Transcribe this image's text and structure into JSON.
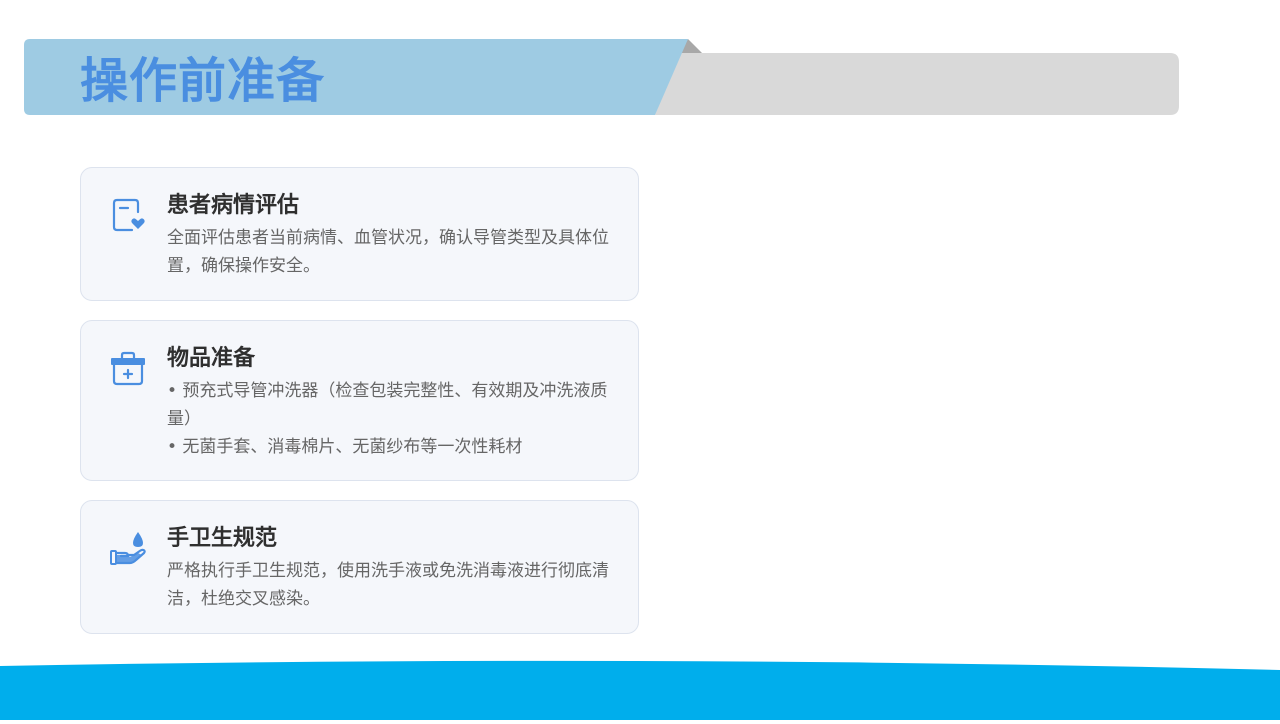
{
  "colors": {
    "banner_blue": "#9ecbe3",
    "banner_gray": "#d9d9d9",
    "title_text": "#4a8ee0",
    "icon_blue": "#4a8ee0",
    "card_background": "#f5f7fb",
    "footer_blue": "#00aeec"
  },
  "header": {
    "title": "操作前准备"
  },
  "cards": [
    {
      "icon": "clipboard-heart-icon",
      "title": "患者病情评估",
      "body": [
        "全面评估患者当前病情、血管状况，确认导管类型及具体位置，确保操作安全。"
      ]
    },
    {
      "icon": "medical-kit-icon",
      "title": "物品准备",
      "body": [
        "• 预充式导管冲洗器（检查包装完整性、有效期及冲洗液质量）",
        "• 无菌手套、消毒棉片、无菌纱布等一次性耗材"
      ]
    },
    {
      "icon": "hand-droplet-icon",
      "title": "手卫生规范",
      "body": [
        "严格执行手卫生规范，使用洗手液或免洗消毒液进行彻底清洁，杜绝交叉感染。"
      ]
    }
  ]
}
